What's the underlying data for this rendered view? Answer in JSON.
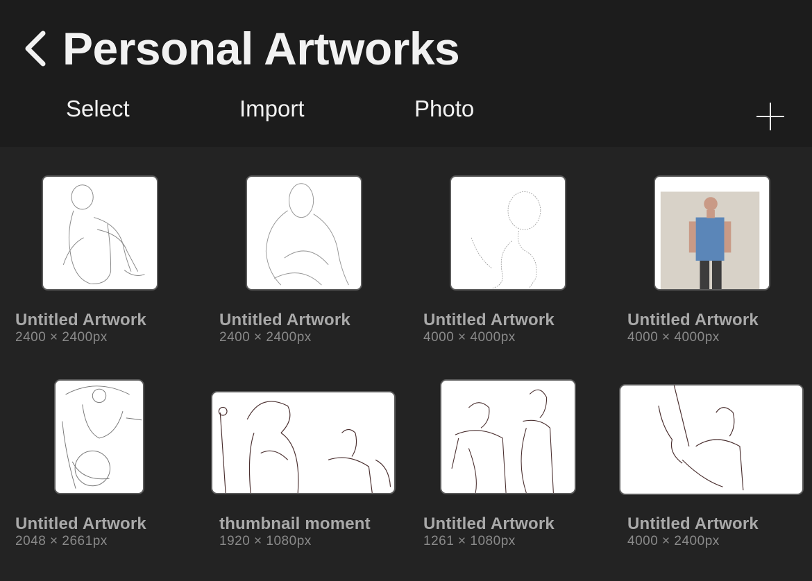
{
  "header": {
    "title": "Personal Artworks",
    "back_icon": "chevron-left-icon",
    "actions": {
      "select": "Select",
      "import": "Import",
      "photo": "Photo"
    },
    "add_icon": "plus-icon"
  },
  "artworks": [
    {
      "name": "Untitled Artwork",
      "dimensions": "2400 × 2400px"
    },
    {
      "name": "Untitled Artwork",
      "dimensions": "2400 × 2400px"
    },
    {
      "name": "Untitled Artwork",
      "dimensions": "4000 × 4000px"
    },
    {
      "name": "Untitled Artwork",
      "dimensions": "4000 × 4000px"
    },
    {
      "name": "Untitled Artwork",
      "dimensions": "2048 × 2661px"
    },
    {
      "name": "thumbnail moment",
      "dimensions": "1920 × 1080px"
    },
    {
      "name": "Untitled Artwork",
      "dimensions": "1261 × 1080px"
    },
    {
      "name": "Untitled Artwork",
      "dimensions": "4000 × 2400px"
    }
  ],
  "colors": {
    "background": "#232323",
    "header": "#1c1c1c",
    "text": "#f2f2f2",
    "caption": "#a9a9a9"
  }
}
